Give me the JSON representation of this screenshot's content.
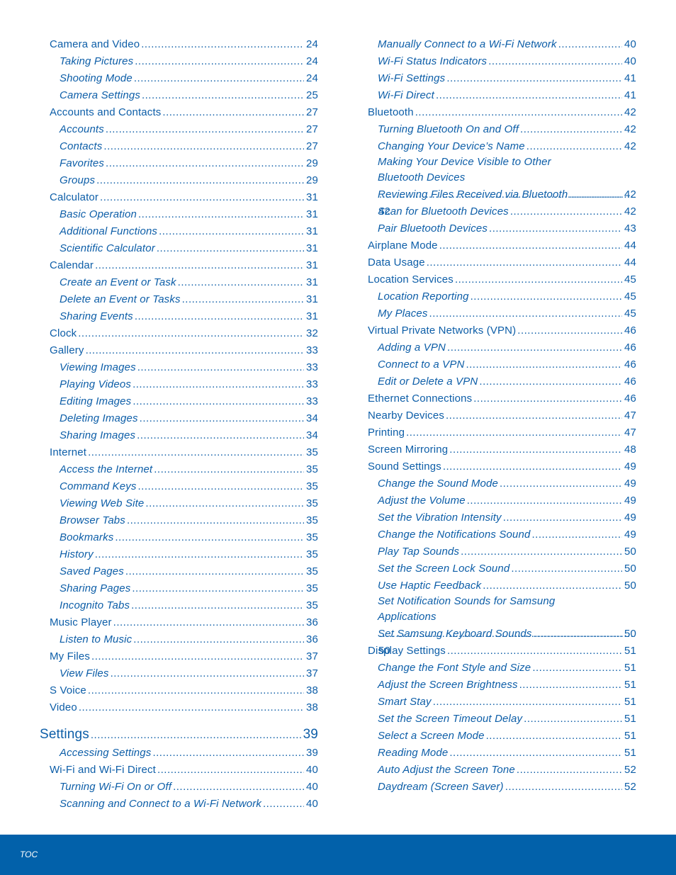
{
  "colors": {
    "text": "#0d5ea8",
    "footer_bg": "#0261aa",
    "footer_text": "#ffffff"
  },
  "left_column": [
    {
      "label": "Camera and Video",
      "page": "24",
      "level": 1
    },
    {
      "label": "Taking Pictures",
      "page": "24",
      "level": 2
    },
    {
      "label": "Shooting Mode",
      "page": "24",
      "level": 2
    },
    {
      "label": "Camera Settings",
      "page": "25",
      "level": 2
    },
    {
      "label": "Accounts and Contacts",
      "page": "27",
      "level": 1
    },
    {
      "label": "Accounts",
      "page": "27",
      "level": 2
    },
    {
      "label": "Contacts",
      "page": "27",
      "level": 2
    },
    {
      "label": "Favorites",
      "page": "29",
      "level": 2
    },
    {
      "label": "Groups",
      "page": "29",
      "level": 2
    },
    {
      "label": "Calculator",
      "page": "31",
      "level": 1
    },
    {
      "label": "Basic Operation",
      "page": "31",
      "level": 2
    },
    {
      "label": "Additional Functions",
      "page": "31",
      "level": 2
    },
    {
      "label": "Scientific Calculator",
      "page": "31",
      "level": 2
    },
    {
      "label": "Calendar",
      "page": "31",
      "level": 1
    },
    {
      "label": "Create an Event or Task",
      "page": "31",
      "level": 2
    },
    {
      "label": "Delete an Event or Tasks",
      "page": "31",
      "level": 2
    },
    {
      "label": "Sharing Events",
      "page": "31",
      "level": 2
    },
    {
      "label": "Clock",
      "page": "32",
      "level": 1
    },
    {
      "label": "Gallery",
      "page": "33",
      "level": 1
    },
    {
      "label": "Viewing Images",
      "page": "33",
      "level": 2
    },
    {
      "label": "Playing Videos",
      "page": "33",
      "level": 2
    },
    {
      "label": "Editing Images",
      "page": "33",
      "level": 2
    },
    {
      "label": "Deleting Images",
      "page": "34",
      "level": 2
    },
    {
      "label": "Sharing Images",
      "page": "34",
      "level": 2
    },
    {
      "label": "Internet",
      "page": "35",
      "level": 1
    },
    {
      "label": "Access the Internet",
      "page": "35",
      "level": 2
    },
    {
      "label": "Command Keys",
      "page": "35",
      "level": 2
    },
    {
      "label": "Viewing Web Site",
      "page": "35",
      "level": 2
    },
    {
      "label": "Browser Tabs",
      "page": "35",
      "level": 2
    },
    {
      "label": "Bookmarks",
      "page": "35",
      "level": 2
    },
    {
      "label": "History",
      "page": "35",
      "level": 2
    },
    {
      "label": "Saved Pages",
      "page": "35",
      "level": 2
    },
    {
      "label": "Sharing Pages",
      "page": "35",
      "level": 2
    },
    {
      "label": "Incognito Tabs",
      "page": "35",
      "level": 2
    },
    {
      "label": "Music Player",
      "page": "36",
      "level": 1
    },
    {
      "label": "Listen to Music",
      "page": "36",
      "level": 2
    },
    {
      "label": "My Files",
      "page": "37",
      "level": 1
    },
    {
      "label": "View Files",
      "page": "37",
      "level": 2
    },
    {
      "label": "S Voice",
      "page": "38",
      "level": 1
    },
    {
      "label": "Video",
      "page": "38",
      "level": 1
    },
    {
      "label": "Settings",
      "page": "39",
      "level": 0
    },
    {
      "label": "Accessing Settings",
      "page": "39",
      "level": 2
    },
    {
      "label": "Wi-Fi and Wi-Fi Direct",
      "page": "40",
      "level": 1
    },
    {
      "label": "Turning Wi-Fi On or Off",
      "page": "40",
      "level": 2
    },
    {
      "label": "Scanning and Connect to a Wi-Fi Network",
      "page": "40",
      "level": 2
    }
  ],
  "right_column": [
    {
      "label": "Manually Connect to a Wi-Fi Network",
      "page": "40",
      "level": 2
    },
    {
      "label": "Wi-Fi Status Indicators",
      "page": "40",
      "level": 2
    },
    {
      "label": "Wi-Fi Settings",
      "page": "41",
      "level": 2
    },
    {
      "label": "Wi-Fi Direct",
      "page": "41",
      "level": 2
    },
    {
      "label": "Bluetooth",
      "page": "42",
      "level": 1
    },
    {
      "label": "Turning Bluetooth On and Off",
      "page": "42",
      "level": 2
    },
    {
      "label": "Changing Your Device’s Name",
      "page": "42",
      "level": 2
    },
    {
      "label_line1": "Making Your Device Visible to Other",
      "label": "Bluetooth Devices",
      "page": "42",
      "level": 2
    },
    {
      "label": "Reviewing Files Received via Bluetooth",
      "page": "42",
      "level": 2
    },
    {
      "label": "Scan for Bluetooth Devices",
      "page": "42",
      "level": 2
    },
    {
      "label": "Pair Bluetooth Devices",
      "page": "43",
      "level": 2
    },
    {
      "label": "Airplane Mode",
      "page": "44",
      "level": 1
    },
    {
      "label": "Data Usage",
      "page": "44",
      "level": 1
    },
    {
      "label": "Location Services",
      "page": "45",
      "level": 1
    },
    {
      "label": "Location Reporting",
      "page": "45",
      "level": 2
    },
    {
      "label": "My Places",
      "page": "45",
      "level": 2
    },
    {
      "label": "Virtual Private Networks (VPN)",
      "page": "46",
      "level": 1
    },
    {
      "label": "Adding a VPN",
      "page": "46",
      "level": 2
    },
    {
      "label": "Connect to a VPN",
      "page": "46",
      "level": 2
    },
    {
      "label": "Edit or Delete a VPN",
      "page": "46",
      "level": 2
    },
    {
      "label": "Ethernet Connections",
      "page": "46",
      "level": 1
    },
    {
      "label": "Nearby Devices",
      "page": "47",
      "level": 1
    },
    {
      "label": "Printing",
      "page": "47",
      "level": 1
    },
    {
      "label": "Screen Mirroring",
      "page": "48",
      "level": 1
    },
    {
      "label": "Sound Settings",
      "page": "49",
      "level": 1
    },
    {
      "label": "Change the Sound Mode",
      "page": "49",
      "level": 2
    },
    {
      "label": "Adjust the Volume",
      "page": "49",
      "level": 2
    },
    {
      "label": "Set the Vibration Intensity",
      "page": "49",
      "level": 2
    },
    {
      "label": "Change the Notifications Sound",
      "page": "49",
      "level": 2
    },
    {
      "label": "Play Tap Sounds",
      "page": "50",
      "level": 2
    },
    {
      "label": "Set the Screen Lock Sound",
      "page": "50",
      "level": 2
    },
    {
      "label": "Use Haptic Feedback",
      "page": "50",
      "level": 2
    },
    {
      "label_line1": "Set Notification Sounds for Samsung",
      "label": "Applications",
      "page": "50",
      "level": 2
    },
    {
      "label": "Set Samsung Keyboard Sounds",
      "page": "50",
      "level": 2
    },
    {
      "label": "Display Settings",
      "page": "51",
      "level": 1
    },
    {
      "label": "Change the Font Style and Size",
      "page": "51",
      "level": 2
    },
    {
      "label": "Adjust the Screen Brightness",
      "page": "51",
      "level": 2
    },
    {
      "label": "Smart Stay",
      "page": "51",
      "level": 2
    },
    {
      "label": "Set the Screen Timeout Delay",
      "page": "51",
      "level": 2
    },
    {
      "label": "Select a Screen Mode",
      "page": "51",
      "level": 2
    },
    {
      "label": "Reading Mode",
      "page": "51",
      "level": 2
    },
    {
      "label": "Auto Adjust the Screen Tone",
      "page": "52",
      "level": 2
    },
    {
      "label": "Daydream (Screen Saver)",
      "page": "52",
      "level": 2
    }
  ],
  "footer": {
    "label": "TOC"
  }
}
